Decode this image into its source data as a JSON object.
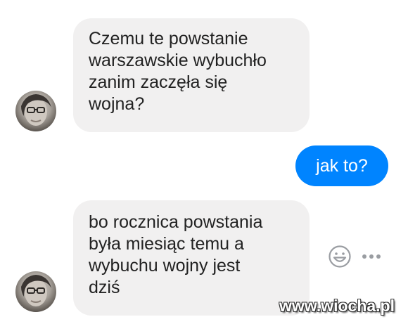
{
  "conversation": {
    "messages": [
      {
        "direction": "incoming",
        "text": "Czemu te powstanie\nwarszawskie wybuchło\nzanim zaczęła się\nwojna?"
      },
      {
        "direction": "outgoing",
        "text": "jak to?"
      },
      {
        "direction": "incoming",
        "text": "bo rocznica powstania\nbyła miesiąc temu a\nwybuchu wojny jest\ndziś"
      }
    ]
  },
  "actions": {
    "reaction_icon": "smiley-face-icon",
    "more_icon": "more-options-icon"
  },
  "watermark": {
    "text": "www.wiocha.pl"
  },
  "colors": {
    "incoming_bubble": "#f1f0f0",
    "outgoing_bubble": "#0084ff",
    "outgoing_text": "#ffffff",
    "incoming_text": "#222222",
    "icon_gray": "#9a9da2"
  }
}
